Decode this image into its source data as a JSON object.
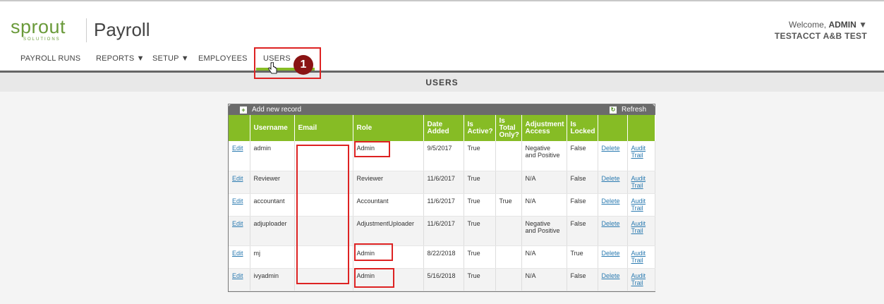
{
  "header": {
    "logo_text": "sprout",
    "logo_sub": "SOLUTIONS",
    "app_title": "Payroll",
    "welcome_prefix": "Welcome,",
    "welcome_user": "ADMIN",
    "account": "TESTACCT A&B TEST"
  },
  "nav": {
    "items": [
      {
        "label": "PAYROLL RUNS"
      },
      {
        "label": "REPORTS ▼"
      },
      {
        "label": "SETUP ▼"
      },
      {
        "label": "EMPLOYEES"
      },
      {
        "label": "USERS"
      }
    ],
    "active": "USERS"
  },
  "section": {
    "title": "USERS"
  },
  "grid": {
    "add_label": "Add new record",
    "refresh_label": "Refresh",
    "columns": [
      "",
      "Username",
      "Email",
      "Role",
      "Date Added",
      "Is Active?",
      "Is Total Only?",
      "Adjustment Access",
      "Is Locked",
      "",
      ""
    ],
    "rows": [
      {
        "edit": "Edit",
        "username": "admin",
        "email": "",
        "role": "Admin",
        "date": "9/5/2017",
        "active": "True",
        "total": "",
        "adjust": "Negative and Positive",
        "locked": "False",
        "delete": "Delete",
        "audit": "Audit Trail"
      },
      {
        "edit": "Edit",
        "username": "Reviewer",
        "email": "",
        "role": "Reviewer",
        "date": "11/6/2017",
        "active": "True",
        "total": "",
        "adjust": "N/A",
        "locked": "False",
        "delete": "Delete",
        "audit": "Audit Trail"
      },
      {
        "edit": "Edit",
        "username": "accountant",
        "email": "",
        "role": "Accountant",
        "date": "11/6/2017",
        "active": "True",
        "total": "True",
        "adjust": "N/A",
        "locked": "False",
        "delete": "Delete",
        "audit": "Audit Trail"
      },
      {
        "edit": "Edit",
        "username": "adjuploader",
        "email": "",
        "role": "AdjustmentUploader",
        "date": "11/6/2017",
        "active": "True",
        "total": "",
        "adjust": "Negative and Positive",
        "locked": "False",
        "delete": "Delete",
        "audit": "Audit Trail"
      },
      {
        "edit": "Edit",
        "username": "mj",
        "email": "",
        "role": "Admin",
        "date": "8/22/2018",
        "active": "True",
        "total": "",
        "adjust": "N/A",
        "locked": "True",
        "delete": "Delete",
        "audit": "Audit Trail"
      },
      {
        "edit": "Edit",
        "username": "ivyadmin",
        "email": "",
        "role": "Admin",
        "date": "5/16/2018",
        "active": "True",
        "total": "",
        "adjust": "N/A",
        "locked": "False",
        "delete": "Delete",
        "audit": "Audit Trail"
      }
    ]
  },
  "annotation": {
    "step_number": "1"
  },
  "colors": {
    "brand_green": "#86bc25",
    "callout_red": "#d22222",
    "badge": "#8a1414"
  }
}
